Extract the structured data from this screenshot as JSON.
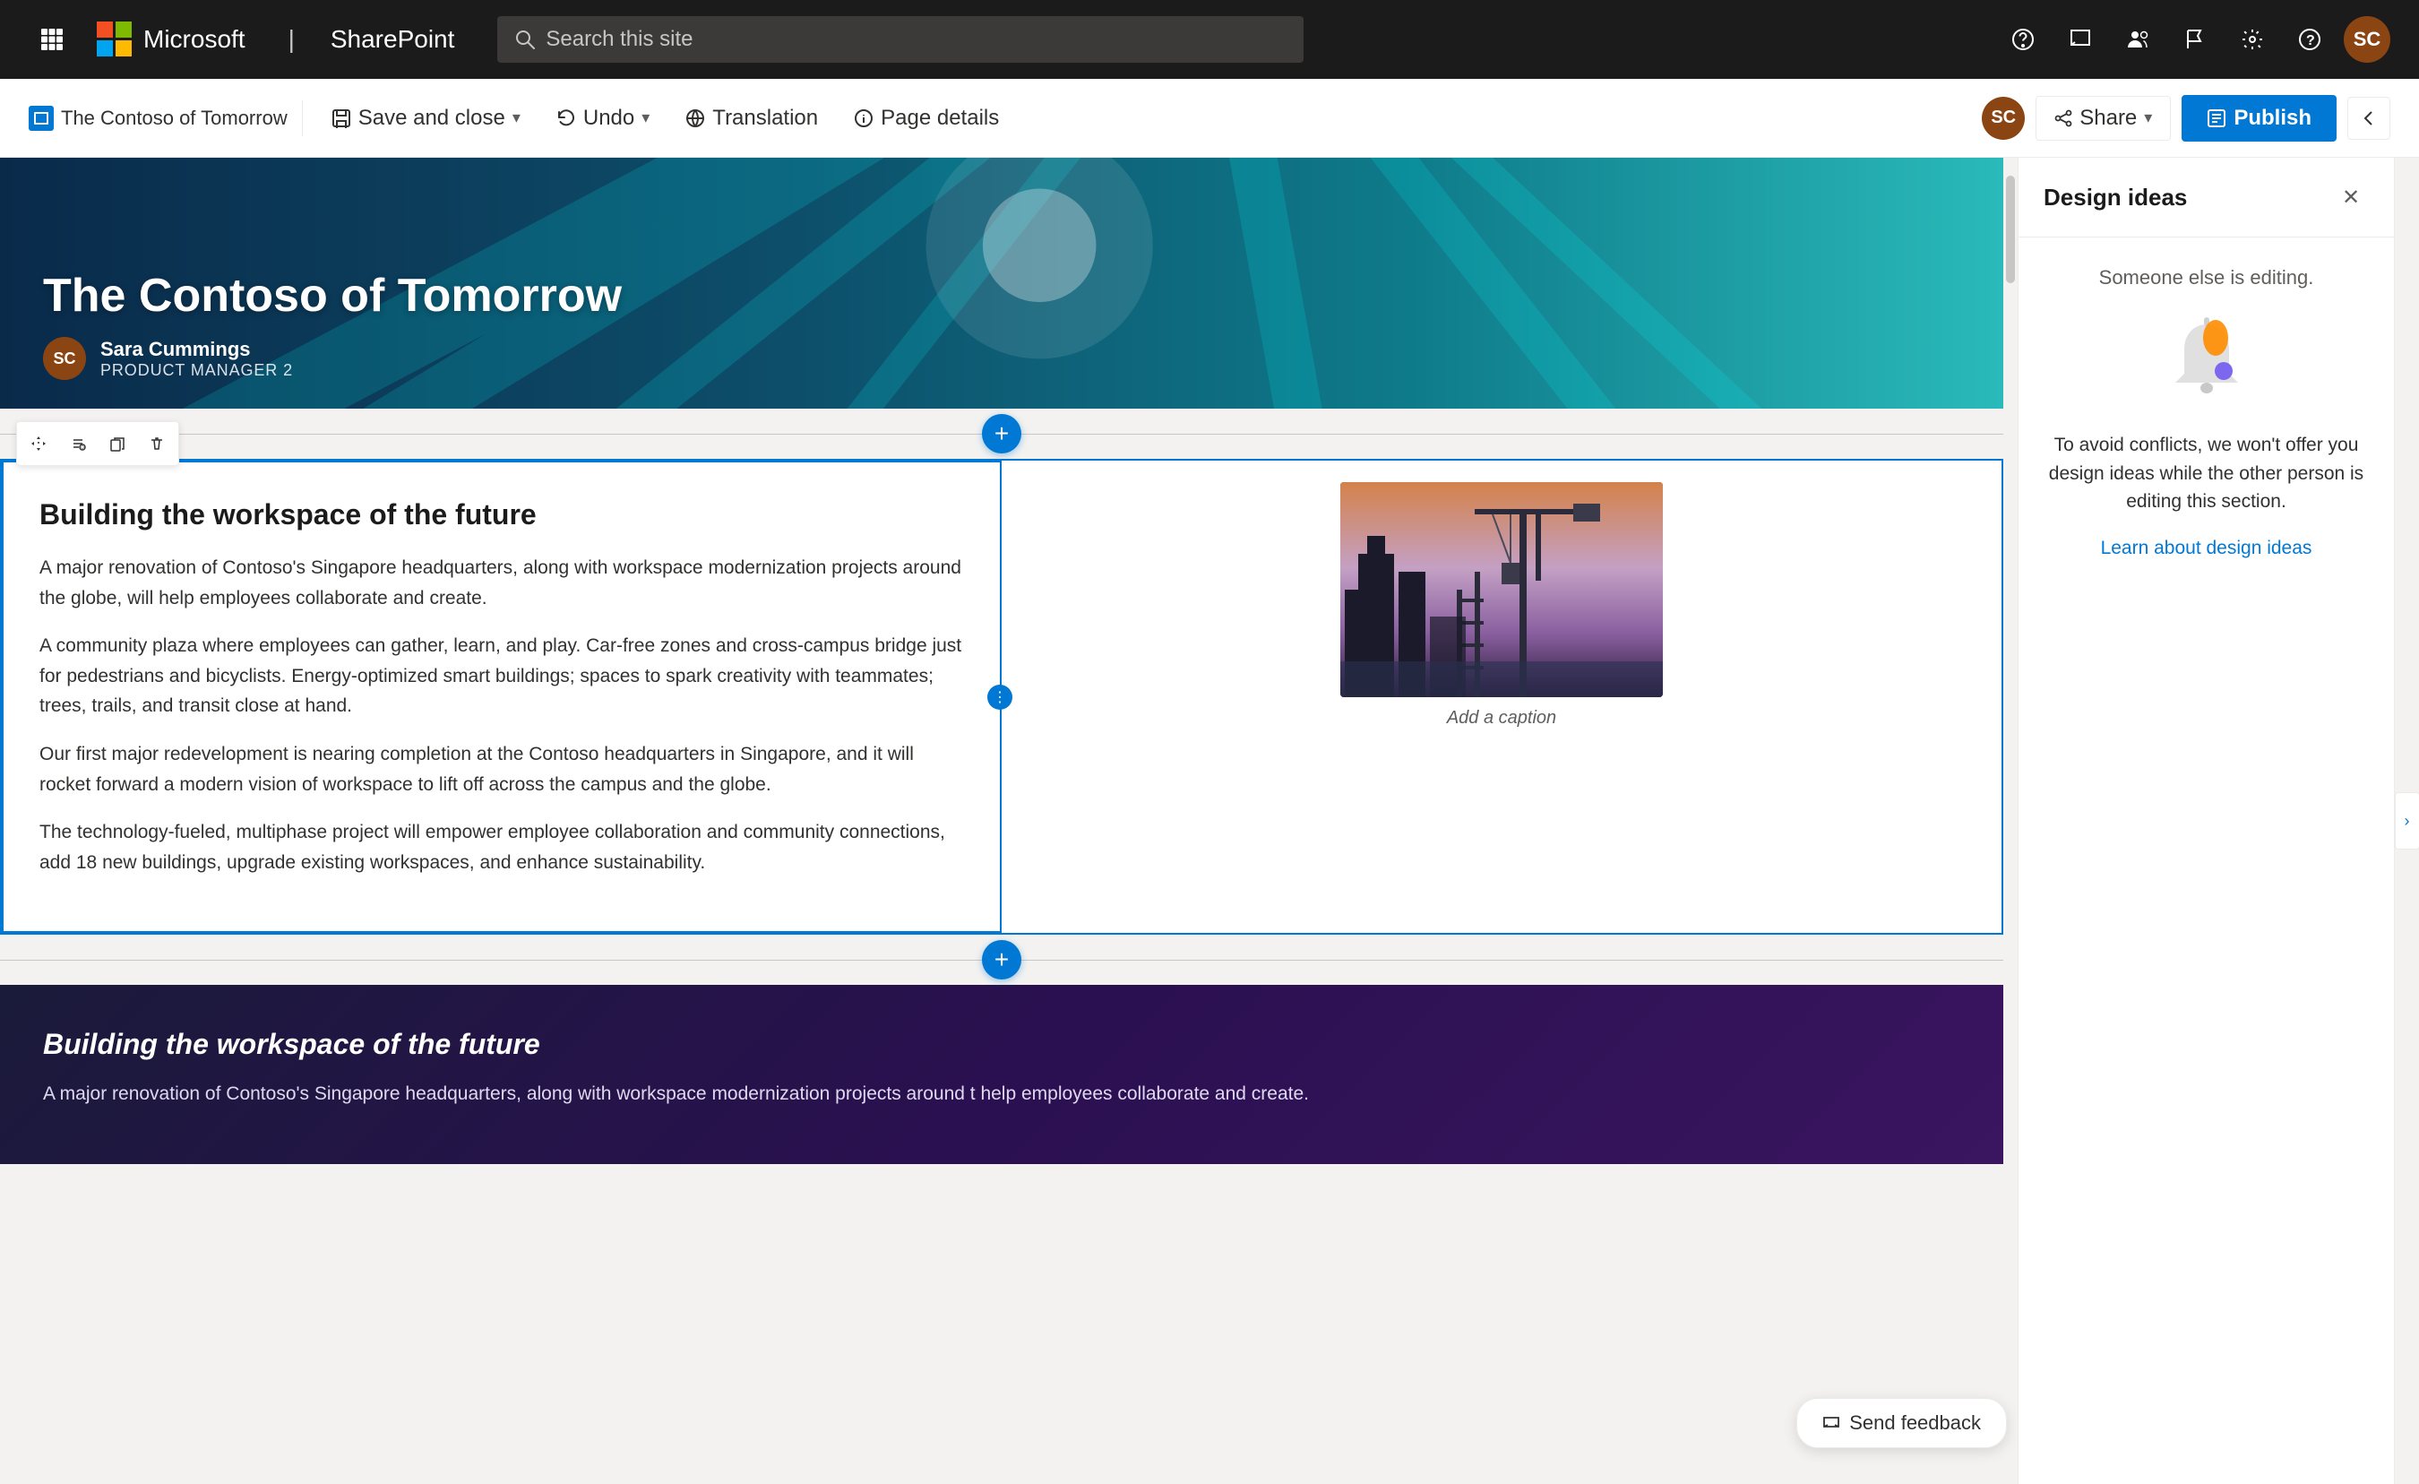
{
  "nav": {
    "app_name": "Microsoft",
    "sharepoint": "SharePoint",
    "search_placeholder": "Search this site"
  },
  "toolbar": {
    "page_label": "The Contoso of Tomorrow",
    "save_close": "Save and close",
    "undo": "Undo",
    "translation": "Translation",
    "page_details": "Page details",
    "share": "Share",
    "publish": "Publish"
  },
  "hero": {
    "title": "The Contoso of Tomorrow",
    "author_name": "Sara Cummings",
    "author_role": "PRODUCT MANAGER 2"
  },
  "content_section": {
    "heading": "Building the workspace of the future",
    "paragraph1": "A major renovation of Contoso's Singapore headquarters, along with workspace modernization projects around the globe, will help employees collaborate and create.",
    "paragraph2": "A community plaza where employees can gather, learn, and play. Car-free zones and cross-campus bridge just for pedestrians and bicyclists. Energy-optimized smart buildings; spaces to spark creativity with teammates; trees, trails, and transit close at hand.",
    "paragraph3": "Our first major redevelopment is nearing completion at the Contoso headquarters in Singapore, and it will rocket forward a modern vision of workspace to lift off across the campus and the globe.",
    "paragraph4": "The technology-fueled, multiphase project will empower employee collaboration and community connections, add 18 new buildings, upgrade existing workspaces, and enhance sustainability.",
    "image_caption": "Add a caption"
  },
  "dark_section": {
    "heading": "Building the workspace of the future",
    "paragraph": "A major renovation of Contoso's Singapore headquarters, along with workspace modernization projects around t help employees collaborate and create."
  },
  "design_panel": {
    "title": "Design ideas",
    "someone_editing": "Someone else is editing.",
    "conflict_message": "To avoid conflicts, we won't offer you design ideas while the other person is editing this section.",
    "learn_link": "Learn about design ideas"
  },
  "send_feedback": {
    "label": "Send feedback"
  },
  "icons": {
    "search": "🔍",
    "waffle": "⊞",
    "share_icon": "↗",
    "publish_icon": "📄",
    "move": "✥",
    "settings_sliders": "⚙",
    "copy": "⧉",
    "delete": "🗑",
    "drag_handle": "⋮",
    "close": "✕",
    "plus": "+",
    "collapse": "❮",
    "feedback_icon": "💬"
  }
}
